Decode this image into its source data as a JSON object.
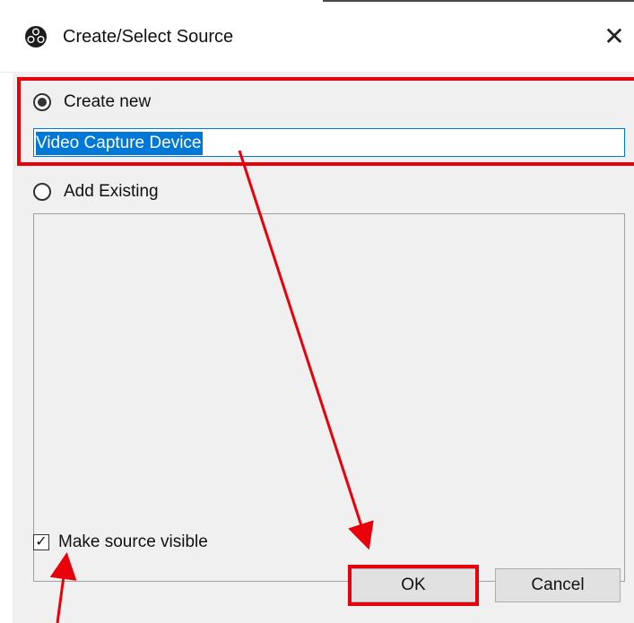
{
  "window": {
    "title": "Create/Select Source",
    "close_glyph": "✕",
    "app_icon": "obs-logo-icon"
  },
  "options": {
    "create_new_label": "Create new",
    "create_new_selected": true,
    "name_value": "Video Capture Device",
    "add_existing_label": "Add Existing",
    "add_existing_selected": false
  },
  "visibility": {
    "label": "Make source visible",
    "checked": true,
    "check_glyph": "✓"
  },
  "buttons": {
    "ok_label": "OK",
    "cancel_label": "Cancel"
  },
  "colors": {
    "annotation_red": "#e8000b",
    "selection_blue": "#0078d7"
  }
}
